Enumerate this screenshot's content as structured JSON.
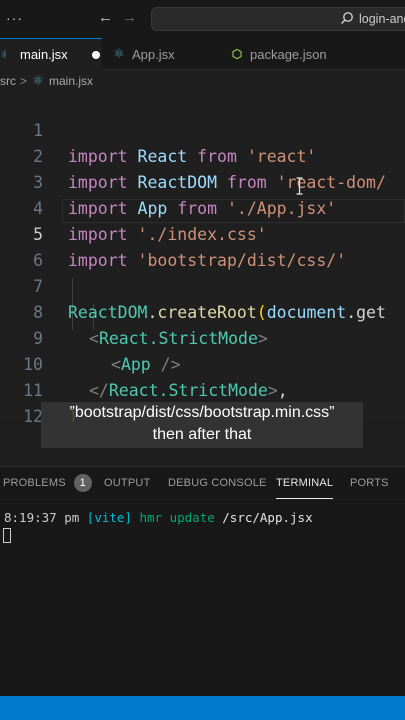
{
  "titlebar": {
    "menu_glyph": "···",
    "back_glyph": "←",
    "forward_glyph": "→",
    "search_text": "login-and"
  },
  "tabs": [
    {
      "label": "main.jsx",
      "icon": "react-icon",
      "active": true,
      "modified": true
    },
    {
      "label": "App.jsx",
      "icon": "react-icon",
      "active": false
    },
    {
      "label": "package.json",
      "icon": "json-icon",
      "active": false
    }
  ],
  "breadcrumb": {
    "folder": "src",
    "separator": ">",
    "file": "main.jsx"
  },
  "editor": {
    "current_line": 5,
    "line_numbers": [
      "1",
      "2",
      "3",
      "4",
      "5",
      "6",
      "7",
      "8",
      "9",
      "10",
      "11",
      "12"
    ],
    "lines": [
      {
        "kw": "import",
        "id": " React",
        "kw2": " from",
        "str": " 'react'"
      },
      {
        "kw": "import",
        "id": " ReactDOM",
        "kw2": " from",
        "str": " 'react-dom/"
      },
      {
        "kw": "import",
        "id": " App",
        "kw2": " from",
        "str": " './App.jsx'"
      },
      {
        "kw": "import",
        "str": " './index.css'"
      },
      {
        "kw": "import",
        "str": " 'bootstrap/dist/css/'"
      },
      {
        "a": "ReactDOM",
        "b": ".",
        "c": "createRoot",
        "d": "(",
        "e": "document",
        "f": ".get"
      },
      {
        "open": "<",
        "name": "React.StrictMode",
        "close": ">"
      },
      {
        "open": "<",
        "name": "App",
        "close": " />"
      },
      {
        "open": "</",
        "name": "React.StrictMode",
        "close": ">",
        "comma": ","
      },
      {
        "paren": ")"
      }
    ]
  },
  "subtitle": {
    "line1": "”bootstrap/dist/css/bootstrap.min.css”",
    "line2": "then after that"
  },
  "panel": {
    "tabs": [
      "PROBLEMS",
      "OUTPUT",
      "DEBUG CONSOLE",
      "TERMINAL",
      "PORTS"
    ],
    "problems_count": "1",
    "active_tab": "TERMINAL"
  },
  "terminal": {
    "time": "8:19:37 pm",
    "tag": "[vite]",
    "message": "hmr update",
    "path": "/src/App.jsx"
  },
  "colors": {
    "accent": "#0078d4",
    "statusbar": "#007acc",
    "editor_bg": "#1f1f1f"
  }
}
